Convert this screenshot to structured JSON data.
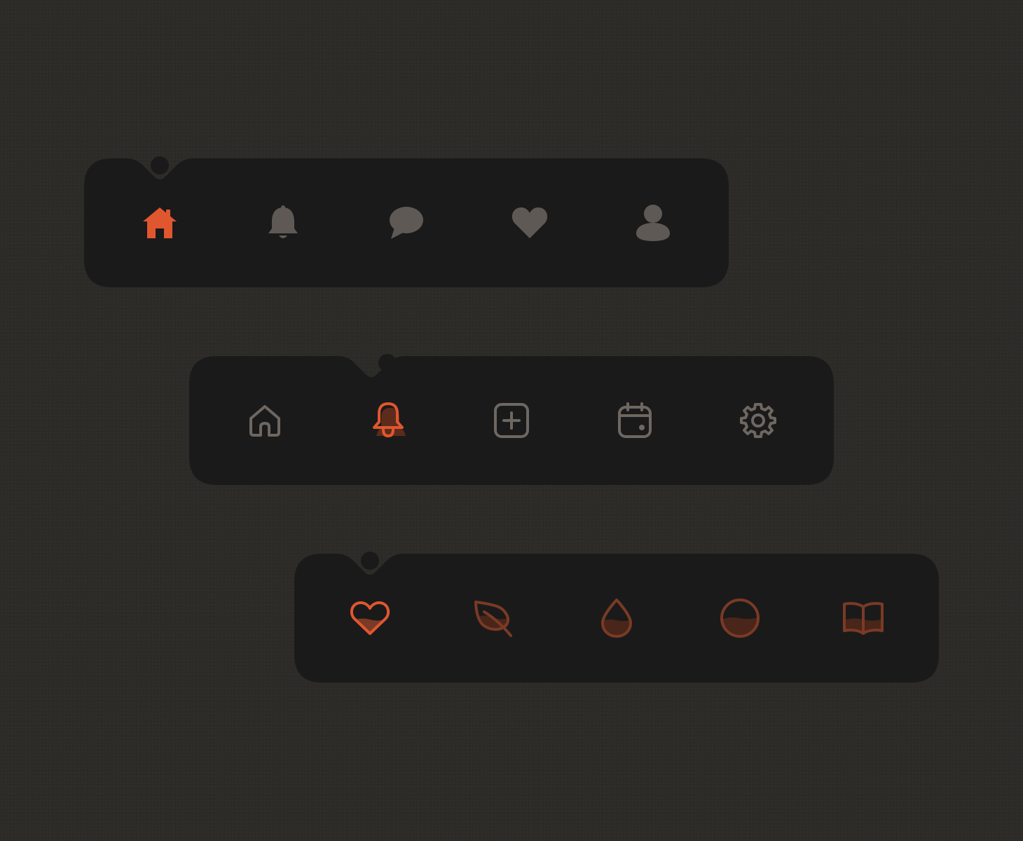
{
  "colors": {
    "background": "#2d2b28",
    "bar": "#1a1a1a",
    "accent": "#e0562f",
    "icon_muted": "#5e5955",
    "icon_outline_muted": "#6e6761",
    "icon_accent_muted": "#7a3a25",
    "icon_accent_fill": "#5c2b1c"
  },
  "tab_bars": [
    {
      "style": "filled",
      "active_index": 0,
      "items": [
        {
          "icon": "home-icon",
          "active": true
        },
        {
          "icon": "bell-icon",
          "active": false
        },
        {
          "icon": "chat-bubble-icon",
          "active": false
        },
        {
          "icon": "heart-icon",
          "active": false
        },
        {
          "icon": "user-icon",
          "active": false
        }
      ]
    },
    {
      "style": "outline",
      "active_index": 1,
      "items": [
        {
          "icon": "home-icon",
          "active": false
        },
        {
          "icon": "bell-icon",
          "active": true
        },
        {
          "icon": "plus-square-icon",
          "active": false
        },
        {
          "icon": "calendar-icon",
          "active": false
        },
        {
          "icon": "gear-icon",
          "active": false
        }
      ]
    },
    {
      "style": "liquid-fill",
      "active_index": 0,
      "items": [
        {
          "icon": "heart-icon",
          "active": true
        },
        {
          "icon": "leaf-icon",
          "active": false
        },
        {
          "icon": "drop-icon",
          "active": false
        },
        {
          "icon": "circle-icon",
          "active": false
        },
        {
          "icon": "book-icon",
          "active": false
        }
      ]
    }
  ]
}
